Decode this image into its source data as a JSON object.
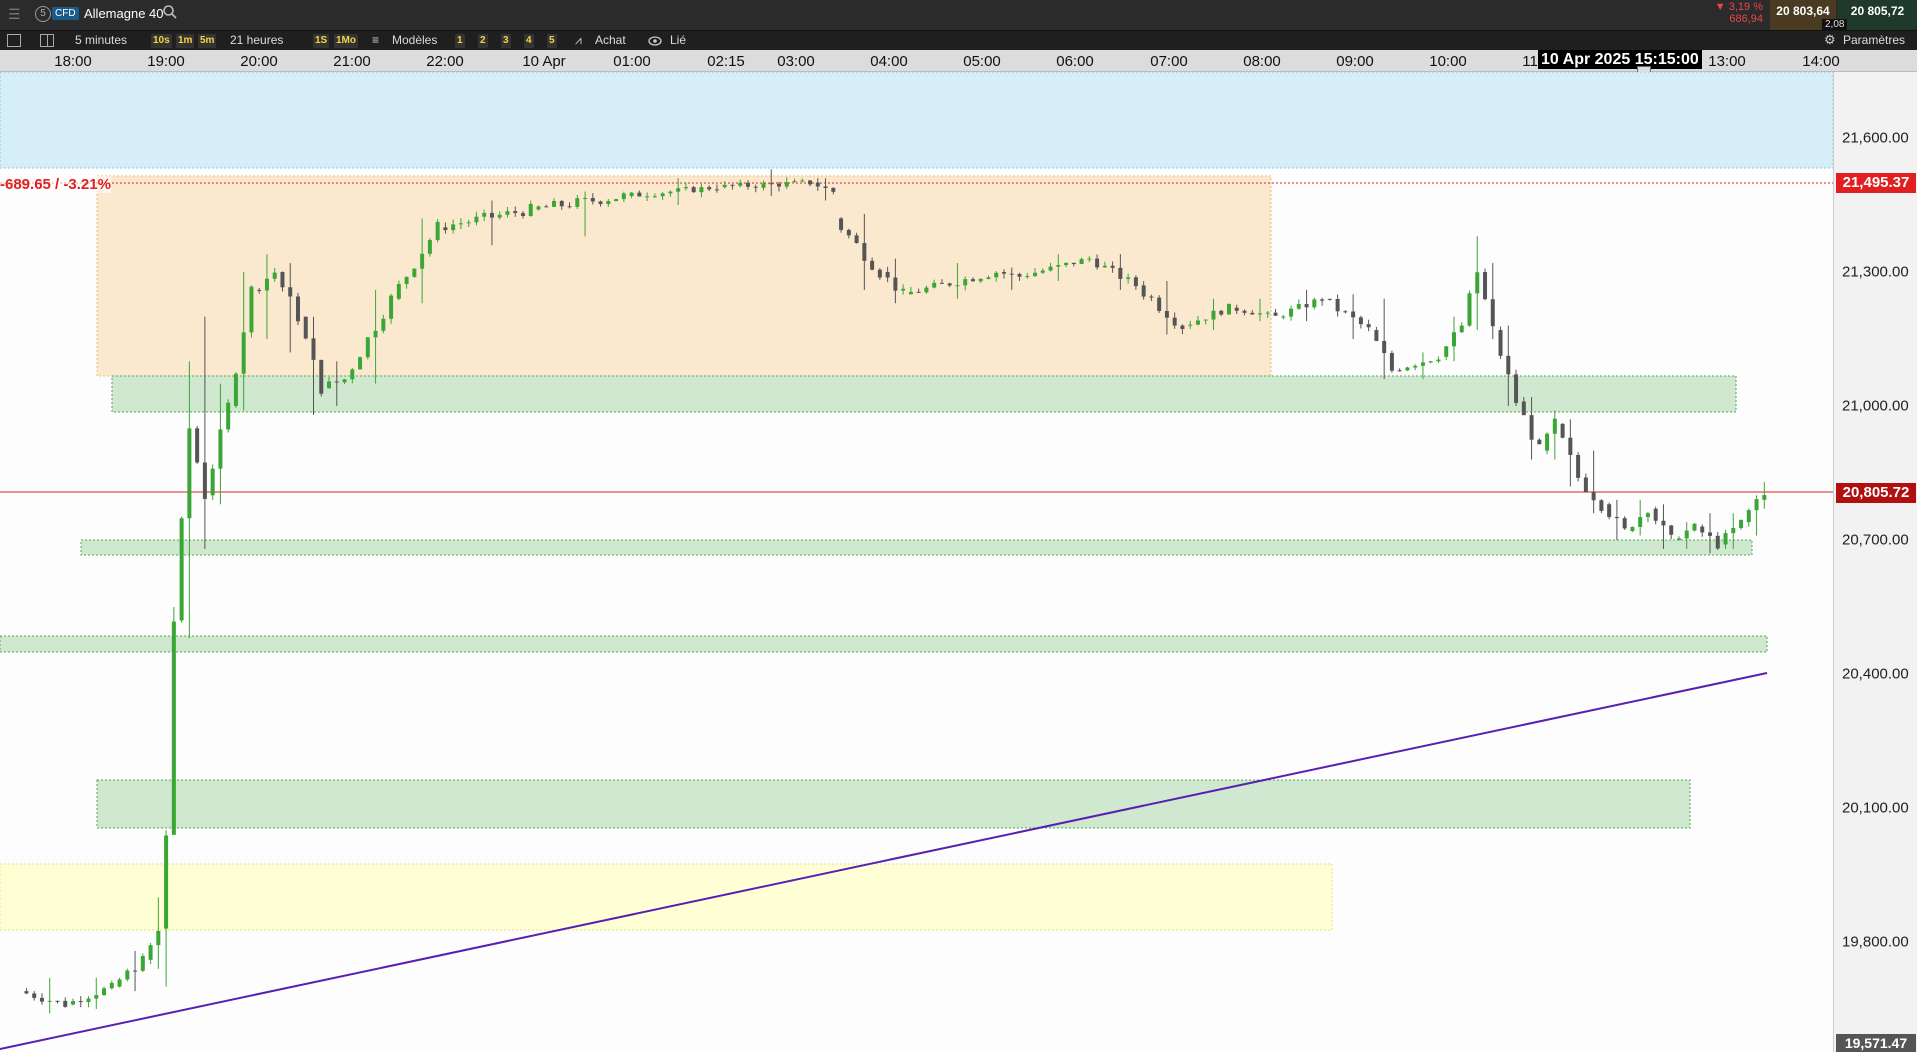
{
  "instrument": {
    "type_badge": "CFD",
    "name": "Allemagne 40",
    "change_pct": "▼ 3,19 %",
    "change_abs": "686,94",
    "bid": "20 803,64",
    "ask": "20 805,72",
    "spread": "2,08"
  },
  "toolbar": {
    "interval": "5 minutes",
    "range": "21 heures",
    "quick_intervals": [
      "10s",
      "1m",
      "5m"
    ],
    "quick_ranges": [
      "1S",
      "1Mo"
    ],
    "templates_label": "Modèles",
    "presets": [
      "1",
      "2",
      "3",
      "4",
      "5"
    ],
    "buy_label": "Achat",
    "linked_label": "Lié",
    "settings_label": "Paramètres"
  },
  "time_axis": {
    "ticks": [
      "18:00",
      "19:00",
      "20:00",
      "21:00",
      "22:00",
      "10 Apr",
      "01:00",
      "02:15",
      "03:00",
      "04:00",
      "05:00",
      "06:00",
      "07:00",
      "08:00",
      "09:00",
      "10:00",
      "11",
      "13:00",
      "14:00"
    ],
    "cursor_label": "10 Apr 2025 15:15:00"
  },
  "price_axis": {
    "ticks": [
      "21,600.00",
      "21,300.00",
      "21,000.00",
      "20,700.00",
      "20,400.00",
      "20,100.00",
      "19,800.00"
    ],
    "ref_price_label": "21,495.37",
    "current_price_label": "20,805.72",
    "bottom_label": "19,571.47"
  },
  "annotation": {
    "change_label": "-689.65 / -3.21%"
  },
  "colors": {
    "up_candle": "#3aa635",
    "down_candle": "#555555",
    "ref_line": "#e02020",
    "trend_line": "#5a1fb0",
    "zone_green": "#cfe8cf",
    "zone_orange": "#fbe9cf",
    "zone_yellow": "#ffffd6",
    "zone_blue": "#d6eef8"
  },
  "chart_data": {
    "type": "candlestick",
    "symbol": "Allemagne 40",
    "interval": "5 minutes",
    "ohlc_anchor": [
      [
        "17:30",
        19690,
        19720,
        19640,
        19660
      ],
      [
        "18:00",
        19660,
        19720,
        19650,
        19700
      ],
      [
        "18:30",
        19700,
        19780,
        19690,
        19760
      ],
      [
        "18:50",
        19760,
        19900,
        19740,
        19820
      ],
      [
        "19:00",
        19830,
        20050,
        19700,
        20040
      ],
      [
        "19:05",
        20040,
        20550,
        20040,
        20520
      ],
      [
        "19:10",
        20520,
        21100,
        20480,
        20950
      ],
      [
        "19:20",
        20950,
        21200,
        20680,
        20800
      ],
      [
        "19:30",
        20800,
        21050,
        20780,
        21000
      ],
      [
        "19:45",
        21000,
        21300,
        20990,
        21260
      ],
      [
        "20:00",
        21260,
        21340,
        21150,
        21300
      ],
      [
        "20:15",
        21300,
        21320,
        21120,
        21200
      ],
      [
        "20:30",
        21200,
        21200,
        20980,
        21040
      ],
      [
        "20:45",
        21040,
        21100,
        21000,
        21060
      ],
      [
        "21:00",
        21060,
        21260,
        21050,
        21240
      ],
      [
        "21:30",
        21240,
        21420,
        21230,
        21400
      ],
      [
        "22:00",
        21400,
        21460,
        21360,
        21440
      ],
      [
        "23:00",
        21440,
        21480,
        21380,
        21470
      ],
      [
        "00:00",
        21470,
        21510,
        21450,
        21490
      ],
      [
        "01:00",
        21490,
        21530,
        21470,
        21500
      ],
      [
        "02:00",
        21500,
        21510,
        21460,
        21480
      ],
      [
        "02:15",
        21420,
        21430,
        21260,
        21300
      ],
      [
        "02:45",
        21300,
        21330,
        21230,
        21250
      ],
      [
        "03:00",
        21250,
        21320,
        21240,
        21300
      ],
      [
        "04:00",
        21300,
        21310,
        21260,
        21290
      ],
      [
        "04:15",
        21290,
        21340,
        21280,
        21330
      ],
      [
        "05:00",
        21330,
        21340,
        21260,
        21270
      ],
      [
        "05:30",
        21270,
        21280,
        21160,
        21180
      ],
      [
        "06:00",
        21180,
        21240,
        21170,
        21220
      ],
      [
        "06:30",
        21220,
        21240,
        21190,
        21200
      ],
      [
        "07:00",
        21200,
        21260,
        21190,
        21240
      ],
      [
        "07:30",
        21240,
        21250,
        21150,
        21170
      ],
      [
        "08:00",
        21170,
        21240,
        21060,
        21080
      ],
      [
        "08:15",
        21080,
        21120,
        21060,
        21110
      ],
      [
        "08:45",
        21110,
        21200,
        21100,
        21180
      ],
      [
        "09:00",
        21180,
        21380,
        21170,
        21300
      ],
      [
        "09:10",
        21300,
        21320,
        21150,
        21170
      ],
      [
        "09:20",
        21170,
        21180,
        21000,
        21010
      ],
      [
        "09:35",
        21010,
        21020,
        20880,
        20900
      ],
      [
        "09:50",
        20900,
        20990,
        20880,
        20960
      ],
      [
        "10:00",
        20960,
        20970,
        20820,
        20840
      ],
      [
        "10:15",
        20840,
        20900,
        20760,
        20780
      ],
      [
        "10:30",
        20780,
        20790,
        20700,
        20720
      ],
      [
        "10:45",
        20720,
        20790,
        20710,
        20770
      ],
      [
        "11:00",
        20770,
        20780,
        20680,
        20700
      ],
      [
        "11:15",
        20700,
        20740,
        20680,
        20730
      ],
      [
        "11:30",
        20730,
        20760,
        20670,
        20690
      ],
      [
        "11:45",
        20690,
        20760,
        20680,
        20740
      ],
      [
        "12:00",
        20740,
        20800,
        20710,
        20790
      ],
      [
        "12:10",
        20790,
        20830,
        20770,
        20806
      ]
    ],
    "reference_price": 21495.37,
    "current_price": 20805.72,
    "ylim": [
      19571.47,
      21700
    ],
    "zones": [
      {
        "color": "blue",
        "from": "17:30",
        "to": "14:30",
        "low": 21510,
        "high": 21700
      },
      {
        "color": "orange",
        "from": "19:00",
        "to": "08:15",
        "low": 21050,
        "high": 21500
      },
      {
        "color": "green",
        "from": "19:10",
        "to": "12:45",
        "low": 20980,
        "high": 21060
      },
      {
        "color": "green",
        "from": "18:40",
        "to": "12:45",
        "low": 20670,
        "high": 20710
      },
      {
        "color": "green",
        "from": "17:30",
        "to": "12:55",
        "low": 20460,
        "high": 20495
      },
      {
        "color": "green",
        "from": "19:00",
        "to": "12:35",
        "low": 20060,
        "high": 20170
      },
      {
        "color": "yellow",
        "from": "17:30",
        "to": "08:40",
        "low": 19825,
        "high": 19975
      }
    ],
    "trend_line": {
      "from": [
        "17:30",
        19560
      ],
      "to": [
        "12:55",
        20425
      ]
    }
  }
}
